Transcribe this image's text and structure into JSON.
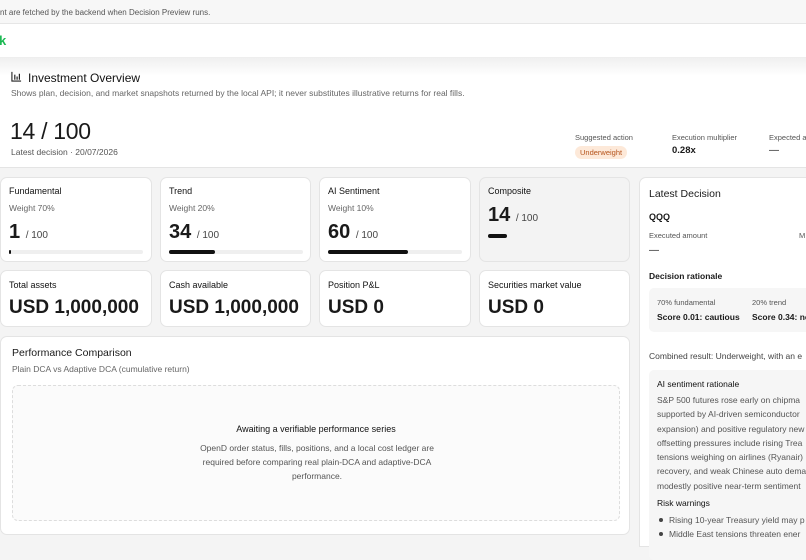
{
  "topbar": {
    "notice": "nt are fetched by the backend when Decision Preview runs."
  },
  "brand": {
    "letter": "k"
  },
  "overview": {
    "title": "Investment Overview",
    "icon": "bar-chart-icon",
    "subtitle": "Shows plan, decision, and market snapshots returned by the local API; it never substitutes illustrative returns for real fills.",
    "score": "14 / 100",
    "latest": "Latest decision · 20/07/2026",
    "suggested_label": "Suggested action",
    "suggested_value": "Underweight",
    "multiplier_label": "Execution multiplier",
    "multiplier_value": "0.28x",
    "expected_label": "Expected a",
    "expected_value": "—"
  },
  "scores": [
    {
      "label": "Fundamental",
      "weight": "Weight 70%",
      "value": "1",
      "of": "/ 100",
      "level": 0.01
    },
    {
      "label": "Trend",
      "weight": "Weight 20%",
      "value": "34",
      "of": "/ 100",
      "level": 0.34
    },
    {
      "label": "AI Sentiment",
      "weight": "Weight 10%",
      "value": "60",
      "of": "/ 100",
      "level": 0.6
    },
    {
      "label": "Composite",
      "weight": "",
      "value": "14",
      "of": "/ 100",
      "level": 0.14
    }
  ],
  "stats": [
    {
      "label": "Total assets",
      "value": "USD 1,000,000"
    },
    {
      "label": "Cash available",
      "value": "USD 1,000,000"
    },
    {
      "label": "Position P&L",
      "value": "USD 0"
    },
    {
      "label": "Securities market value",
      "value": "USD 0"
    }
  ],
  "performance": {
    "title": "Performance Comparison",
    "subtitle": "Plain DCA vs Adaptive DCA (cumulative return)",
    "await_title": "Awaiting a verifiable performance series",
    "await_body": "OpenD order status, fills, positions, and a local cost ledger are required before comparing real plain-DCA and adaptive-DCA performance."
  },
  "latest_decision": {
    "title": "Latest Decision",
    "ticker": "QQQ",
    "executed_label": "Executed amount",
    "executed_value": "—",
    "second_label": "M",
    "rationale_title": "Decision rationale",
    "fundamental_label": "70% fundamental",
    "fundamental_score": "Score 0.01: cautious",
    "trend_label": "20% trend",
    "trend_score": "Score 0.34: ne",
    "combined": "Combined result: Underweight, with an e",
    "ai_title": "AI sentiment rationale",
    "ai_lines": [
      "S&P 500 futures rose early on chipma",
      "supported by AI-driven semiconductor",
      "expansion) and positive regulatory new",
      "offsetting pressures include rising Trea",
      "tensions weighing on airlines (Ryanair)",
      "recovery, and weak Chinese auto dema",
      "modestly positive near-term sentiment"
    ],
    "risk_title": "Risk warnings",
    "risks": [
      "Rising 10-year Treasury yield may p",
      "Middle East tensions threaten ener"
    ]
  }
}
